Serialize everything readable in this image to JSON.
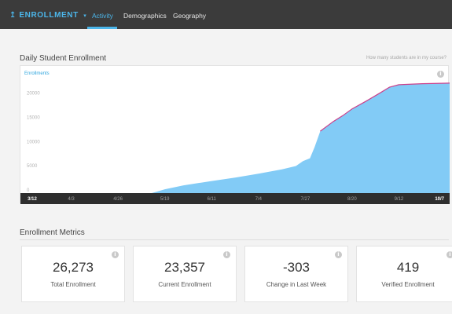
{
  "nav": {
    "brand": "ENROLLMENT",
    "tabs": [
      {
        "label": "Activity",
        "active": true
      },
      {
        "label": "Demographics",
        "active": false
      },
      {
        "label": "Geography",
        "active": false
      }
    ]
  },
  "colors": {
    "nav_bg": "#3b3b3b",
    "accent": "#4cb6ea",
    "area_fill": "#82cbf6",
    "line": "#cc3f8a",
    "axis_bg": "#2e2e2e"
  },
  "enrollment_chart": {
    "title": "Daily Student Enrollment",
    "help_link": "How many students are in my course?",
    "chart_data": {
      "type": "area",
      "legend": [
        "Enrollments"
      ],
      "legend_position": "top-left",
      "grid": false,
      "xlabel": "",
      "ylabel": "",
      "x_ticks": [
        "3/12",
        "4/3",
        "4/26",
        "5/19",
        "6/11",
        "7/4",
        "7/27",
        "8/20",
        "9/12",
        "10/7"
      ],
      "y_ticks": [
        0,
        5000,
        10000,
        15000,
        20000
      ],
      "ylim": [
        0,
        24000
      ],
      "series": [
        {
          "name": "Enrollments",
          "points": [
            [
              0,
              0
            ],
            [
              1,
              0
            ],
            [
              2,
              0
            ],
            [
              2.72,
              0
            ],
            [
              3.0,
              800
            ],
            [
              3.4,
              1600
            ],
            [
              4.0,
              2500
            ],
            [
              4.5,
              3200
            ],
            [
              5.0,
              4000
            ],
            [
              5.5,
              4900
            ],
            [
              5.8,
              5600
            ],
            [
              5.95,
              6600
            ],
            [
              6.1,
              7200
            ],
            [
              6.2,
              9500
            ],
            [
              6.32,
              12800
            ],
            [
              6.6,
              14800
            ],
            [
              6.8,
              16000
            ],
            [
              7.0,
              17400
            ],
            [
              7.3,
              19000
            ],
            [
              7.6,
              20700
            ],
            [
              7.8,
              21900
            ],
            [
              8.0,
              22400
            ],
            [
              8.5,
              22600
            ],
            [
              9.0,
              22700
            ],
            [
              9.5,
              22800
            ],
            [
              9.72,
              22900
            ],
            [
              10,
              22600
            ]
          ]
        }
      ]
    }
  },
  "metrics": {
    "title": "Enrollment Metrics",
    "cards": [
      {
        "value": "26,273",
        "label": "Total Enrollment"
      },
      {
        "value": "23,357",
        "label": "Current Enrollment"
      },
      {
        "value": "-303",
        "label": "Change in Last Week"
      },
      {
        "value": "419",
        "label": "Verified Enrollment"
      }
    ]
  },
  "icons": {
    "info": "i",
    "brand": "↥",
    "caret": "▾"
  }
}
